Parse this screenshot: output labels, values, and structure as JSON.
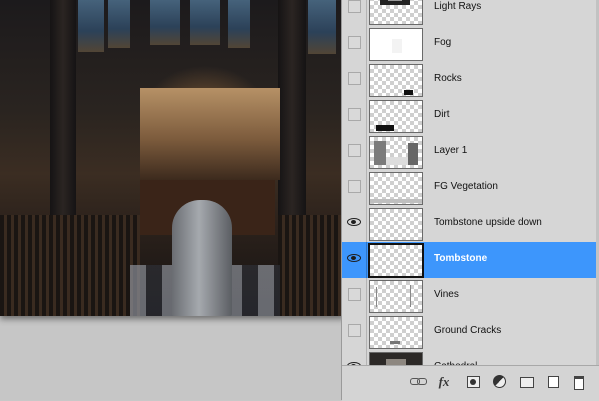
{
  "layers_panel": {
    "layers": [
      {
        "name": "Light Rays",
        "visible": false,
        "selected": false,
        "thumb": "light-rays"
      },
      {
        "name": "Fog",
        "visible": false,
        "selected": false,
        "thumb": "fog"
      },
      {
        "name": "Rocks",
        "visible": false,
        "selected": false,
        "thumb": "rocks"
      },
      {
        "name": "Dirt",
        "visible": false,
        "selected": false,
        "thumb": "dirt"
      },
      {
        "name": "Layer 1",
        "visible": false,
        "selected": false,
        "thumb": "layer1"
      },
      {
        "name": "FG Vegetation",
        "visible": false,
        "selected": false,
        "thumb": "vegetation"
      },
      {
        "name": "Tombstone upside down",
        "visible": true,
        "selected": false,
        "thumb": "empty"
      },
      {
        "name": "Tombstone",
        "visible": true,
        "selected": true,
        "thumb": "empty"
      },
      {
        "name": "Vines",
        "visible": false,
        "selected": false,
        "thumb": "vines"
      },
      {
        "name": "Ground Cracks",
        "visible": false,
        "selected": false,
        "thumb": "cracks"
      },
      {
        "name": "Cathedral",
        "visible": true,
        "selected": false,
        "thumb": "cathedral"
      }
    ],
    "footer_buttons": {
      "link": "link-layers-icon",
      "fx": "fx",
      "mask": "add-mask-icon",
      "adjustment": "adjustment-layer-icon",
      "group": "folder-icon",
      "new_layer": "new-layer-icon",
      "delete": "trash-icon"
    }
  },
  "colors": {
    "selection": "#3d96fc",
    "panel": "#d6d6d6",
    "workspace": "#c6c6c6"
  }
}
